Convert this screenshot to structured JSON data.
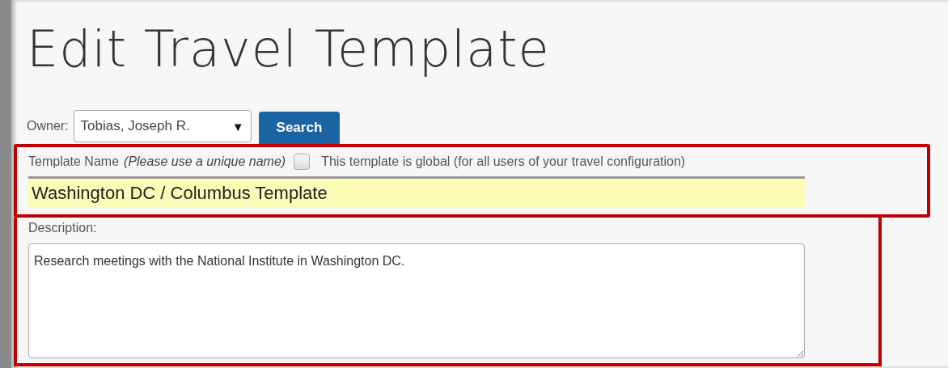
{
  "title": "Edit Travel Template",
  "owner": {
    "label": "Owner:",
    "value": "Tobias, Joseph R.",
    "caret": "▼"
  },
  "search_button": "Search",
  "template_name": {
    "label": "Template Name",
    "hint": "(Please use a unique name)",
    "value": "Washington DC / Columbus Template"
  },
  "global": {
    "label": "This template is global (for all users of your travel configuration)",
    "checked": false
  },
  "description": {
    "label": "Description:",
    "value": "Research meetings with the National Institute in Washington DC."
  }
}
